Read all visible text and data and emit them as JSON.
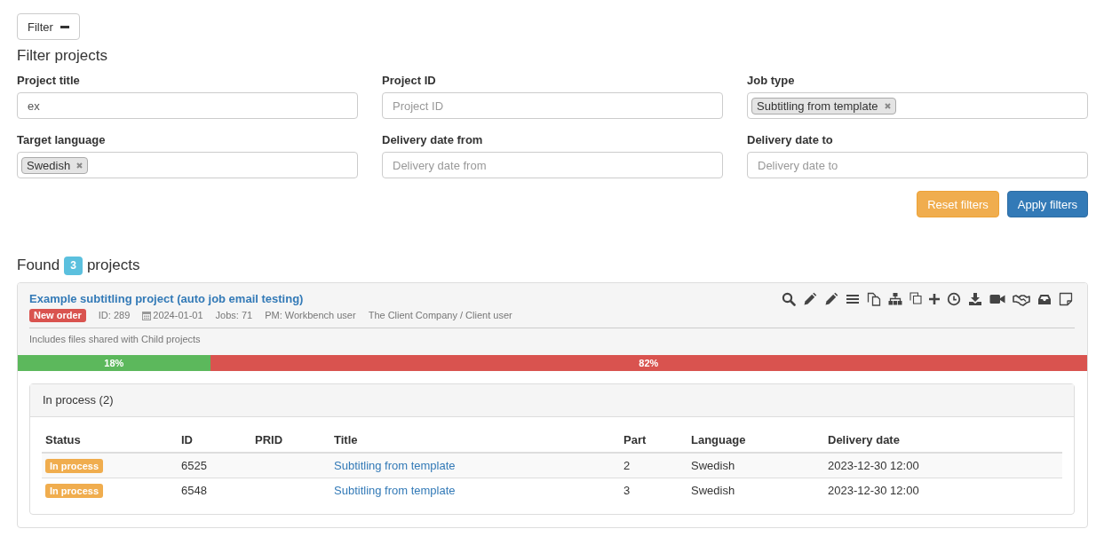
{
  "filter_toggle": {
    "label": "Filter",
    "expanded": true
  },
  "filter_form": {
    "title": "Filter projects",
    "fields": [
      {
        "label": "Project title",
        "kind": "text",
        "value": "ex"
      },
      {
        "label": "Project ID",
        "kind": "text",
        "placeholder": "Project ID"
      },
      {
        "label": "Job type",
        "kind": "tags",
        "tags": [
          "Subtitling from template"
        ]
      },
      {
        "label": "Target language",
        "kind": "tags",
        "tags": [
          "Swedish"
        ]
      },
      {
        "label": "Delivery date from",
        "kind": "text",
        "placeholder": "Delivery date from"
      },
      {
        "label": "Delivery date to",
        "kind": "text",
        "placeholder": "Delivery date to"
      }
    ],
    "buttons": [
      {
        "label": "Reset filters",
        "kind": "warning"
      },
      {
        "label": "Apply filters",
        "kind": "primary"
      }
    ]
  },
  "results": {
    "prefix": "Found",
    "count": "3",
    "suffix": "projects"
  },
  "projects": [
    {
      "title": "Example subtitling project (auto job email testing)",
      "status": {
        "label": "New order",
        "color": "#d9534f"
      },
      "meta": [
        {
          "kind": "text",
          "text": "ID: 289"
        },
        {
          "kind": "date",
          "text": "2024-01-01"
        },
        {
          "kind": "text",
          "text": "Jobs: 71"
        },
        {
          "kind": "text",
          "text": "PM: Workbench user"
        },
        {
          "kind": "text",
          "text": "The Client Company / Client user"
        }
      ],
      "note": "Includes files shared with Child projects",
      "progress": [
        {
          "label": "18%",
          "level": 0.18,
          "color": "#5cb85c"
        },
        {
          "label": "82%",
          "level": 0.82,
          "color": "#d9534f"
        }
      ],
      "groups": [
        {
          "title": "In process (2)",
          "columns": [
            "Status",
            "ID",
            "PRID",
            "Title",
            "Part",
            "Language",
            "Delivery date"
          ],
          "rows": [
            {
              "cells": [
                {
                  "kind": "status",
                  "text": "In process",
                  "color": "#f0ad4e"
                },
                {
                  "kind": "text",
                  "text": "6525"
                },
                null,
                {
                  "kind": "link",
                  "text": "Subtitling from template"
                },
                {
                  "kind": "text",
                  "text": "2"
                },
                {
                  "kind": "text",
                  "text": "Swedish"
                },
                {
                  "kind": "text",
                  "text": "2023-12-30 12:00"
                }
              ]
            },
            {
              "cells": [
                {
                  "kind": "status",
                  "text": "In process",
                  "color": "#f0ad4e"
                },
                {
                  "kind": "text",
                  "text": "6548"
                },
                null,
                {
                  "kind": "link",
                  "text": "Subtitling from template"
                },
                {
                  "kind": "text",
                  "text": "3"
                },
                {
                  "kind": "text",
                  "text": "Swedish"
                },
                {
                  "kind": "text",
                  "text": "2023-12-30 12:00"
                }
              ]
            }
          ]
        }
      ]
    }
  ]
}
